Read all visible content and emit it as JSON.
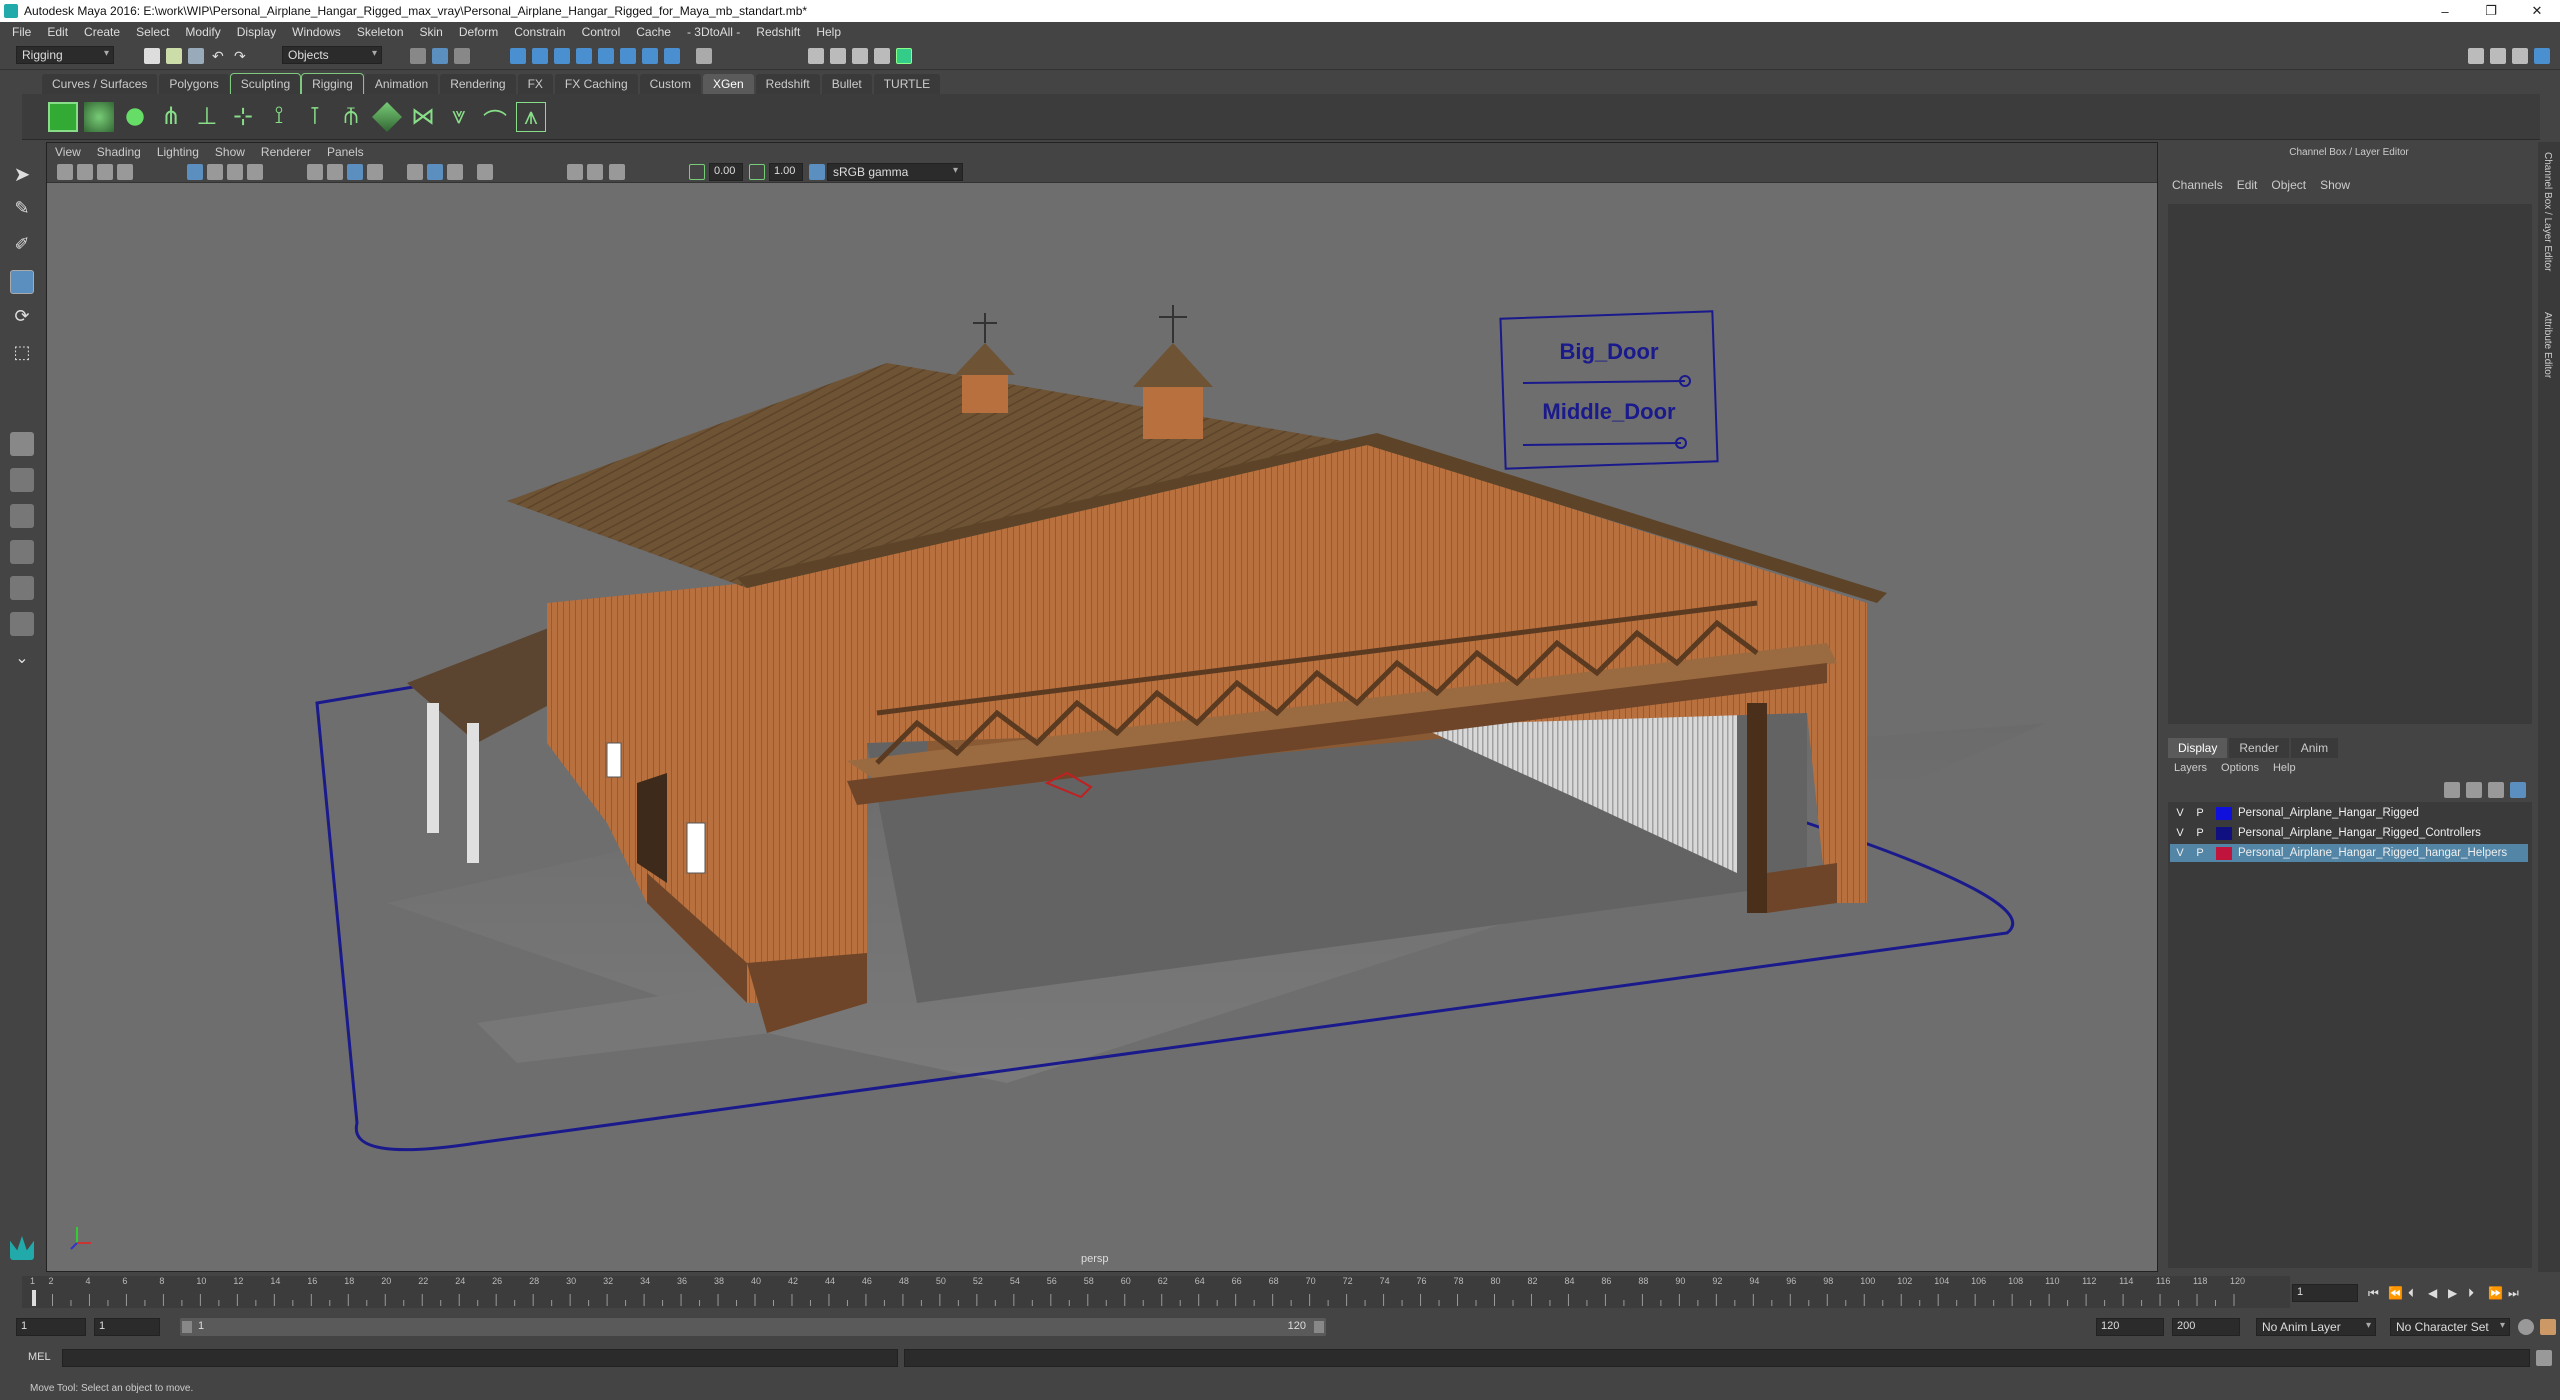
{
  "title": "Autodesk Maya 2016: E:\\work\\WIP\\Personal_Airplane_Hangar_Rigged_max_vray\\Personal_Airplane_Hangar_Rigged_for_Maya_mb_standart.mb*",
  "window_controls": [
    "–",
    "❐",
    "✕"
  ],
  "menubar": [
    "File",
    "Edit",
    "Create",
    "Select",
    "Modify",
    "Display",
    "Windows",
    "Skeleton",
    "Skin",
    "Deform",
    "Constrain",
    "Control",
    "Cache",
    "- 3DtoAll -",
    "Redshift",
    "Help"
  ],
  "statusline": {
    "mode": "Rigging",
    "selection_mask": "Objects"
  },
  "shelf_tabs": [
    {
      "label": "Curves / Surfaces",
      "state": ""
    },
    {
      "label": "Polygons",
      "state": ""
    },
    {
      "label": "Sculpting",
      "state": "boxed"
    },
    {
      "label": "Rigging",
      "state": "boxed"
    },
    {
      "label": "Animation",
      "state": ""
    },
    {
      "label": "Rendering",
      "state": ""
    },
    {
      "label": "FX",
      "state": ""
    },
    {
      "label": "FX Caching",
      "state": ""
    },
    {
      "label": "Custom",
      "state": ""
    },
    {
      "label": "XGen",
      "state": "active"
    },
    {
      "label": "Redshift",
      "state": ""
    },
    {
      "label": "Bullet",
      "state": ""
    },
    {
      "label": "TURTLE",
      "state": ""
    }
  ],
  "viewport": {
    "menu": [
      "View",
      "Shading",
      "Lighting",
      "Show",
      "Renderer",
      "Panels"
    ],
    "exposure": "0.00",
    "gamma": "1.00",
    "color_space": "sRGB gamma",
    "camera": "persp",
    "controller_labels": {
      "big_door": "Big_Door",
      "middle_door": "Middle_Door"
    }
  },
  "channel_box": {
    "title": "Channel Box / Layer Editor",
    "menu": [
      "Channels",
      "Edit",
      "Object",
      "Show"
    ]
  },
  "layer_editor": {
    "tabs": [
      {
        "label": "Display",
        "active": true
      },
      {
        "label": "Render",
        "active": false
      },
      {
        "label": "Anim",
        "active": false
      }
    ],
    "menu": [
      "Layers",
      "Options",
      "Help"
    ],
    "layers": [
      {
        "v": "V",
        "p": "P",
        "color": "#1010dd",
        "name": "Personal_Airplane_Hangar_Rigged",
        "selected": false
      },
      {
        "v": "V",
        "p": "P",
        "color": "#101080",
        "name": "Personal_Airplane_Hangar_Rigged_Controllers",
        "selected": false
      },
      {
        "v": "V",
        "p": "P",
        "color": "#c0143c",
        "name": "Personal_Airplane_Hangar_Rigged_hangar_Helpers",
        "selected": true
      }
    ]
  },
  "side_tabs": [
    "Channel Box / Layer Editor",
    "Attribute Editor"
  ],
  "timeline": {
    "ticks": [
      "1",
      "2",
      "4",
      "6",
      "8",
      "10",
      "12",
      "14",
      "16",
      "18",
      "20",
      "22",
      "24",
      "26",
      "28",
      "30",
      "32",
      "34",
      "36",
      "38",
      "40",
      "42",
      "44",
      "46",
      "48",
      "50",
      "52",
      "54",
      "56",
      "58",
      "60",
      "62",
      "64",
      "66",
      "68",
      "70",
      "72",
      "74",
      "76",
      "78",
      "80",
      "82",
      "84",
      "86",
      "88",
      "90",
      "92",
      "94",
      "96",
      "98",
      "100",
      "102",
      "104",
      "106",
      "108",
      "110",
      "112",
      "114",
      "116",
      "118",
      "120"
    ],
    "current_frame": "1"
  },
  "range": {
    "start": "1",
    "playback_start": "1",
    "range_start_label": "1",
    "range_end_label": "120",
    "playback_end": "120",
    "end": "200",
    "anim_layer": "No Anim Layer",
    "character_set": "No Character Set"
  },
  "command_line": {
    "label": "MEL"
  },
  "help_line": "Move Tool: Select an object to move."
}
